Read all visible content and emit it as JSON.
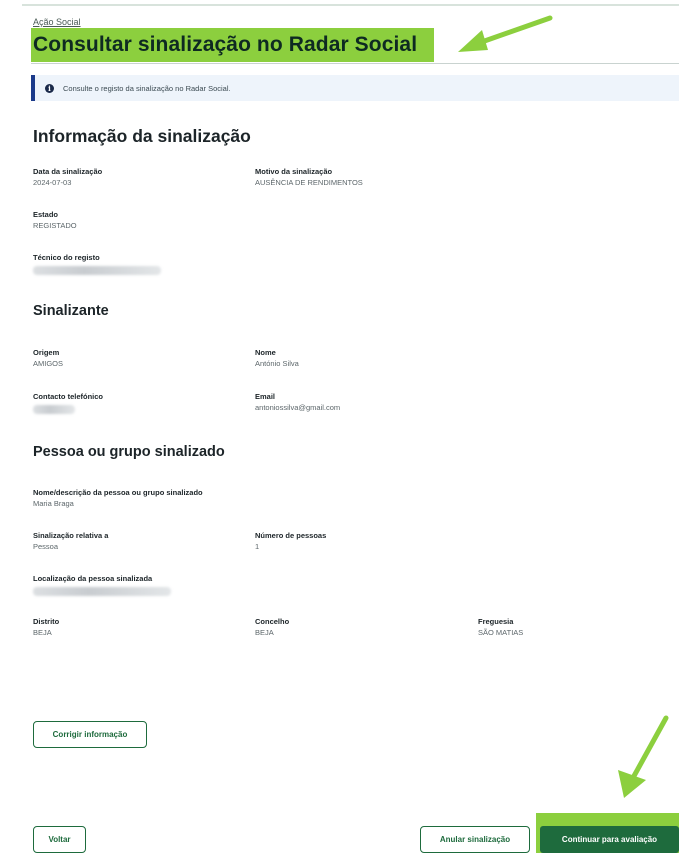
{
  "breadcrumb": "Ação Social",
  "page_title": "Consultar sinalização no Radar Social",
  "info_message": "Consulte o registo da sinalização no Radar Social.",
  "colors": {
    "highlight": "#8ccf3e",
    "primary": "#1e6b3d",
    "info_bar": "#1b3a8a"
  },
  "sections": {
    "info": {
      "title": "Informação da sinalização",
      "data_label": "Data da sinalização",
      "data_value": "2024-07-03",
      "motivo_label": "Motivo da sinalização",
      "motivo_value": "AUSÊNCIA DE RENDIMENTOS",
      "estado_label": "Estado",
      "estado_value": "REGISTADO",
      "tecnico_label": "Técnico do registo"
    },
    "sinalizante": {
      "title": "Sinalizante",
      "origem_label": "Origem",
      "origem_value": "AMIGOS",
      "nome_label": "Nome",
      "nome_value": "António Silva",
      "contacto_label": "Contacto telefónico",
      "email_label": "Email",
      "email_value": "antoniossilva@gmail.com"
    },
    "pessoa": {
      "title": "Pessoa ou grupo sinalizado",
      "nome_label": "Nome/descrição da pessoa ou grupo sinalizado",
      "nome_value": "Maria Braga",
      "relativa_label": "Sinalização relativa a",
      "relativa_value": "Pessoa",
      "numero_label": "Número de pessoas",
      "numero_value": "1",
      "localizacao_label": "Localização da pessoa sinalizada",
      "distrito_label": "Distrito",
      "distrito_value": "BEJA",
      "concelho_label": "Concelho",
      "concelho_value": "BEJA",
      "freguesia_label": "Freguesia",
      "freguesia_value": "SÃO MATIAS"
    }
  },
  "buttons": {
    "corrigir": "Corrigir informação",
    "voltar": "Voltar",
    "anular": "Anular sinalização",
    "continuar": "Continuar para avaliação"
  }
}
